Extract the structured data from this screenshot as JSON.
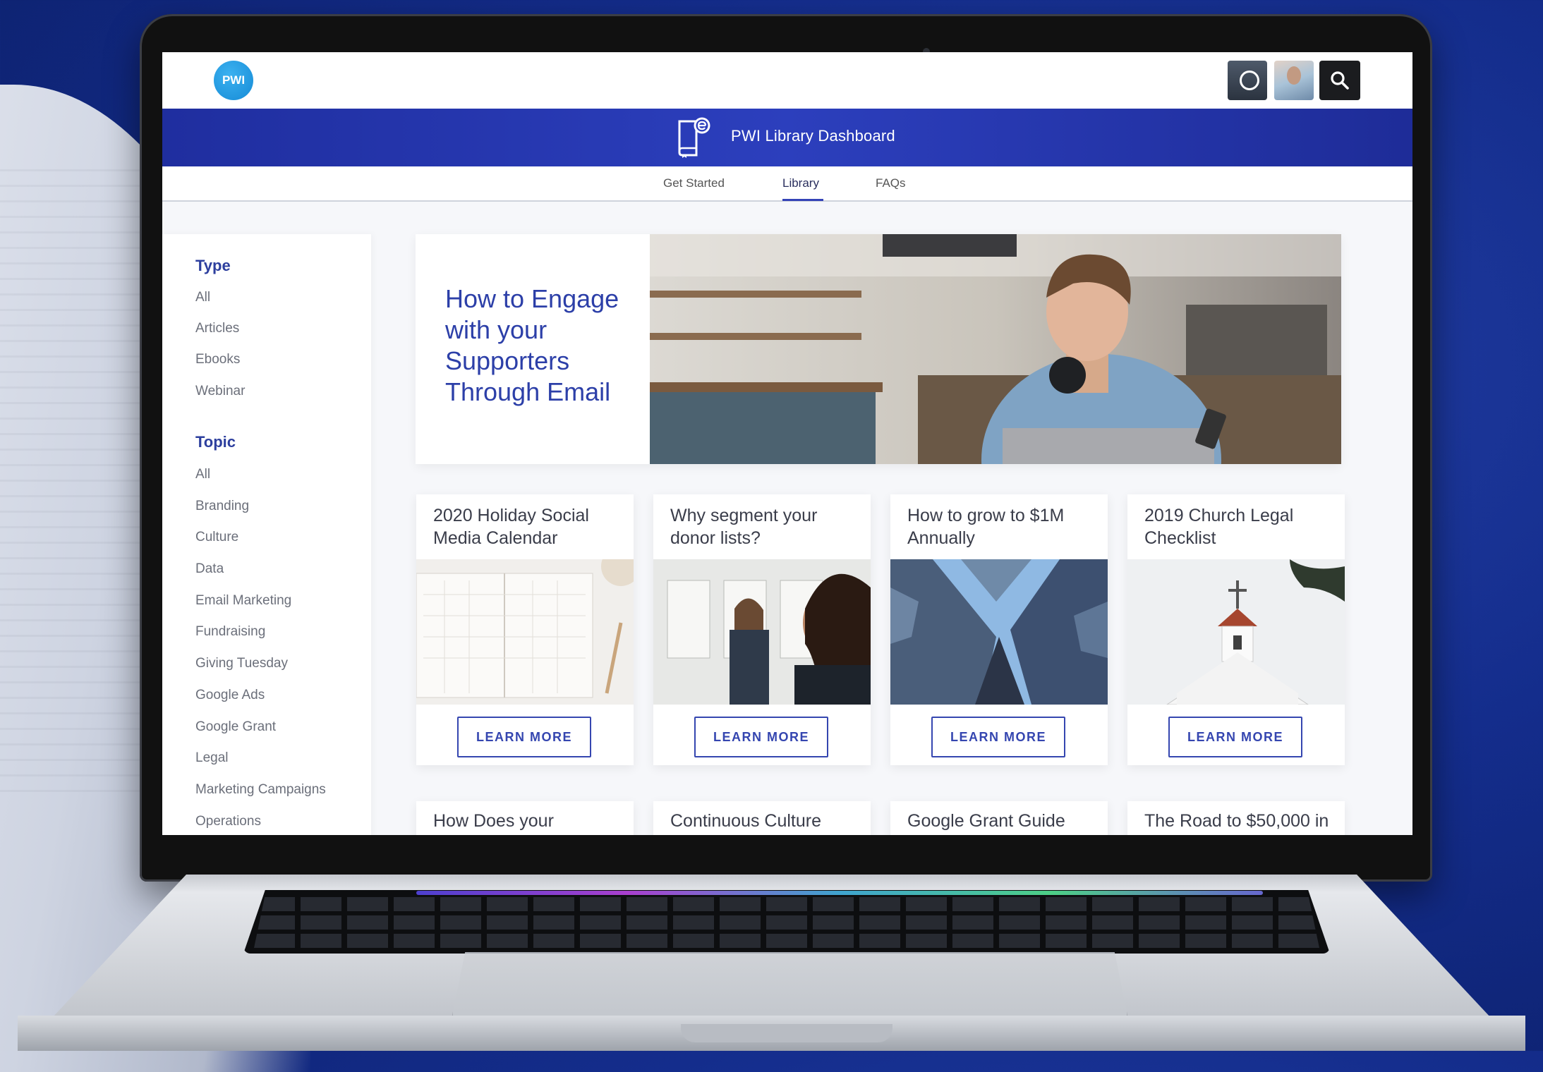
{
  "app": {
    "logo_text": "PWI",
    "header_title": "PWI Library Dashboard"
  },
  "icons": {
    "logo": "pwi-logo-icon",
    "library": "library-book-icon",
    "search": "search-icon",
    "avatar1": "organization-avatar-icon",
    "avatar2": "user-avatar-icon"
  },
  "tabs": [
    {
      "label": "Get Started"
    },
    {
      "label": "Library",
      "active": true
    },
    {
      "label": "FAQs"
    }
  ],
  "sidebar": {
    "type_title": "Type",
    "type_items": [
      "All",
      "Articles",
      "Ebooks",
      "Webinar"
    ],
    "topic_title": "Topic",
    "topic_items": [
      "All",
      "Branding",
      "Culture",
      "Data",
      "Email Marketing",
      "Fundraising",
      "Giving Tuesday",
      "Google Ads",
      "Google Grant",
      "Legal",
      "Marketing Campaigns",
      "Operations"
    ]
  },
  "featured": {
    "title": "How to Engage with your Supporters Through Email"
  },
  "cards": [
    {
      "title": "2020 Holiday Social Media Calendar",
      "button": "LEARN MORE"
    },
    {
      "title": "Why segment your donor lists?",
      "button": "LEARN MORE"
    },
    {
      "title": "How to grow to $1M Annually",
      "button": "LEARN MORE"
    },
    {
      "title": "2019 Church Legal Checklist",
      "button": "LEARN MORE"
    }
  ],
  "cards_row2": [
    {
      "title": "How Does your"
    },
    {
      "title": "Continuous Culture"
    },
    {
      "title": "Google Grant Guide"
    },
    {
      "title": "The Road to $50,000 in"
    }
  ],
  "colors": {
    "brand_blue": "#2c3fa8",
    "header_gradient_start": "#1f2e9f",
    "logo_blue": "#168bd6",
    "background_navy": "#142d8c"
  }
}
